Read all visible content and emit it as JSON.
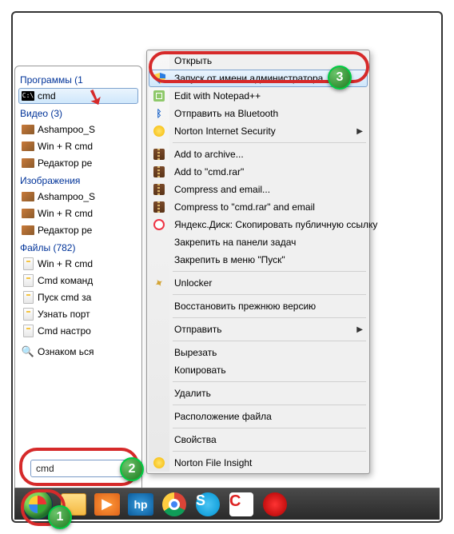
{
  "start_panel": {
    "sections": [
      {
        "title": "Программы (1",
        "items": [
          {
            "icon": "cmd",
            "label": "cmd",
            "selected": true
          }
        ]
      },
      {
        "title": "Видео (3)",
        "items": [
          {
            "icon": "img",
            "label": "Ashampoo_S"
          },
          {
            "icon": "img",
            "label": "Win + R cmd"
          },
          {
            "icon": "img",
            "label": "Редактор ре"
          }
        ]
      },
      {
        "title": "Изображения",
        "items": [
          {
            "icon": "img",
            "label": "Ashampoo_S"
          },
          {
            "icon": "img",
            "label": "Win + R cmd"
          },
          {
            "icon": "img",
            "label": "Редактор ре"
          }
        ]
      },
      {
        "title": "Файлы (782)",
        "items": [
          {
            "icon": "file",
            "label": "Win + R cmd"
          },
          {
            "icon": "file",
            "label": "Cmd команд"
          },
          {
            "icon": "file",
            "label": "Пуск cmd за"
          },
          {
            "icon": "file",
            "label": "Узнать порт"
          },
          {
            "icon": "file",
            "label": "Cmd настро"
          }
        ]
      }
    ],
    "more_results": "Ознаком      ься",
    "search_value": "cmd"
  },
  "context_menu": {
    "groups": [
      [
        {
          "icon": "",
          "label": "Открыть"
        },
        {
          "icon": "shield",
          "label": "Запуск от имени администратора",
          "highlight": true
        },
        {
          "icon": "np",
          "label": "Edit with Notepad++"
        },
        {
          "icon": "bt",
          "label": "Отправить на Bluetooth"
        },
        {
          "icon": "nis",
          "label": "Norton Internet Security",
          "submenu": true
        }
      ],
      [
        {
          "icon": "zip",
          "label": "Add to archive..."
        },
        {
          "icon": "zip",
          "label": "Add to \"cmd.rar\""
        },
        {
          "icon": "zip",
          "label": "Compress and email..."
        },
        {
          "icon": "zip",
          "label": "Compress to \"cmd.rar\" and email"
        },
        {
          "icon": "yd",
          "label": "Яндекс.Диск: Скопировать публичную ссылку"
        },
        {
          "icon": "",
          "label": "Закрепить на панели задач"
        },
        {
          "icon": "",
          "label": "Закрепить в меню \"Пуск\""
        }
      ],
      [
        {
          "icon": "key",
          "label": "Unlocker"
        }
      ],
      [
        {
          "icon": "",
          "label": "Восстановить прежнюю версию"
        }
      ],
      [
        {
          "icon": "",
          "label": "Отправить",
          "submenu": true
        }
      ],
      [
        {
          "icon": "",
          "label": "Вырезать"
        },
        {
          "icon": "",
          "label": "Копировать"
        }
      ],
      [
        {
          "icon": "",
          "label": "Удалить"
        }
      ],
      [
        {
          "icon": "",
          "label": "Расположение файла"
        }
      ],
      [
        {
          "icon": "",
          "label": "Свойства"
        }
      ],
      [
        {
          "icon": "nis",
          "label": "Norton File Insight"
        }
      ]
    ]
  },
  "taskbar": {
    "items": [
      "start",
      "explorer",
      "wmp",
      "hp",
      "chrome",
      "skype",
      "ccleaner",
      "opera"
    ]
  },
  "annotations": {
    "badges": [
      "1",
      "2",
      "3"
    ]
  }
}
